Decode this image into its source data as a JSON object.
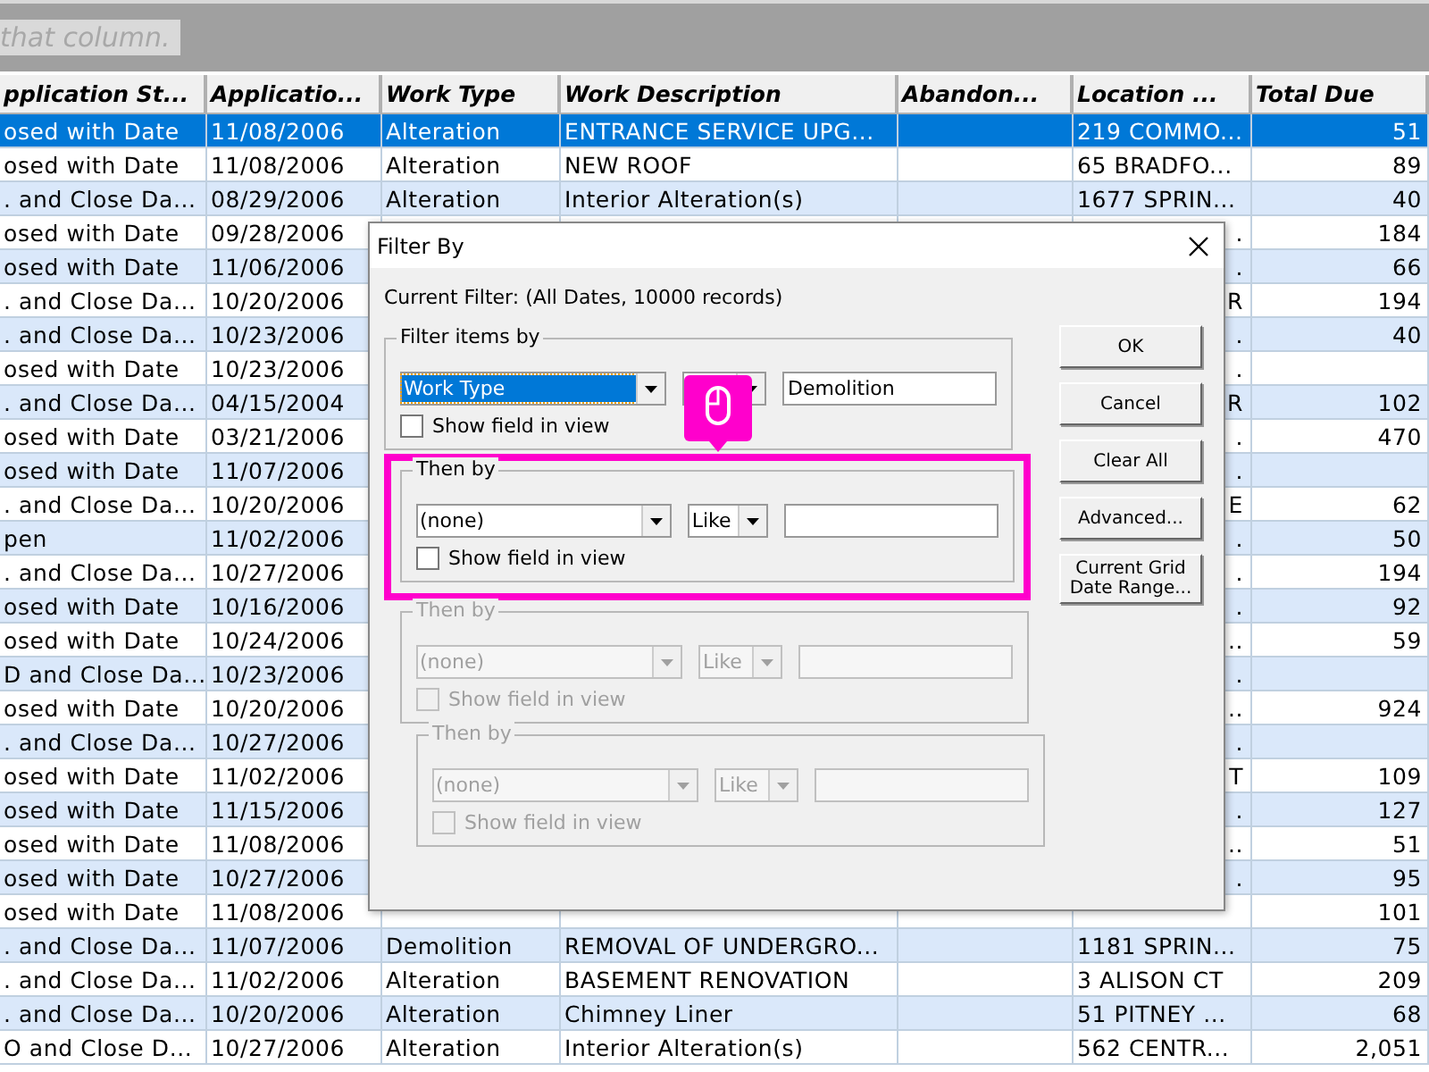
{
  "group_hint": {
    "text": "that column."
  },
  "table": {
    "columns": [
      "pplication St...",
      "Applicatio...",
      "Work Type",
      "Work Description",
      "Abandon...",
      "Location ...",
      "Total Due"
    ],
    "rows": [
      {
        "kind": "full",
        "selected": true,
        "cells": [
          "osed with Date",
          "11/08/2006",
          "Alteration",
          "ENTRANCE SERVICE UPG...",
          null,
          "219 COMMO...",
          "51"
        ]
      },
      {
        "kind": "full",
        "selected": false,
        "cells": [
          "osed with Date",
          "11/08/2006",
          "Alteration",
          "NEW ROOF",
          null,
          "65 BRADFO...",
          "89"
        ]
      },
      {
        "kind": "full",
        "selected": false,
        "cells": [
          ". and Close Da...",
          "08/29/2006",
          "Alteration",
          "Interior Alteration(s)",
          null,
          "1677 SPRIN...",
          "40"
        ]
      },
      {
        "kind": "covered",
        "selected": false,
        "cells": [
          "osed with Date",
          "09/28/2006",
          null,
          null,
          null,
          ".",
          "184"
        ]
      },
      {
        "kind": "covered",
        "selected": false,
        "cells": [
          "osed with Date",
          "11/06/2006",
          null,
          null,
          null,
          ".",
          "66"
        ]
      },
      {
        "kind": "covered",
        "selected": false,
        "cells": [
          ". and Close Da...",
          "10/20/2006",
          null,
          null,
          null,
          "R",
          "194"
        ]
      },
      {
        "kind": "covered",
        "selected": false,
        "cells": [
          ". and Close Da...",
          "10/23/2006",
          null,
          null,
          null,
          ".",
          "40"
        ]
      },
      {
        "kind": "covered",
        "selected": false,
        "cells": [
          "osed with Date",
          "10/23/2006",
          null,
          null,
          null,
          ".",
          null
        ]
      },
      {
        "kind": "covered",
        "selected": false,
        "cells": [
          ". and Close Da...",
          "04/15/2004",
          null,
          null,
          null,
          "R",
          "102"
        ]
      },
      {
        "kind": "covered",
        "selected": false,
        "cells": [
          "osed with Date",
          "03/21/2006",
          null,
          null,
          null,
          ".",
          "470"
        ]
      },
      {
        "kind": "covered",
        "selected": false,
        "cells": [
          "osed with Date",
          "11/07/2006",
          null,
          null,
          null,
          ".",
          null
        ]
      },
      {
        "kind": "covered",
        "selected": false,
        "cells": [
          ". and Close Da...",
          "10/20/2006",
          null,
          null,
          null,
          "E",
          "62"
        ]
      },
      {
        "kind": "covered",
        "selected": false,
        "cells": [
          "pen",
          "11/02/2006",
          null,
          null,
          null,
          ".",
          "50"
        ]
      },
      {
        "kind": "covered",
        "selected": false,
        "cells": [
          ". and Close Da...",
          "10/27/2006",
          null,
          null,
          null,
          ".",
          "194"
        ]
      },
      {
        "kind": "covered",
        "selected": false,
        "cells": [
          "osed with Date",
          "10/16/2006",
          null,
          null,
          null,
          ".",
          "92"
        ]
      },
      {
        "kind": "covered",
        "selected": false,
        "cells": [
          "osed with Date",
          "10/24/2006",
          null,
          null,
          null,
          "..",
          "59"
        ]
      },
      {
        "kind": "covered",
        "selected": false,
        "cells": [
          "D and Close Da...",
          "10/23/2006",
          null,
          null,
          null,
          ".",
          null
        ]
      },
      {
        "kind": "covered",
        "selected": false,
        "cells": [
          "osed with Date",
          "10/20/2006",
          null,
          null,
          null,
          "..",
          "924"
        ]
      },
      {
        "kind": "covered",
        "selected": false,
        "cells": [
          ". and Close Da...",
          "10/27/2006",
          null,
          null,
          null,
          ".",
          null
        ]
      },
      {
        "kind": "covered",
        "selected": false,
        "cells": [
          "osed with Date",
          "11/02/2006",
          null,
          null,
          null,
          "T",
          "109"
        ]
      },
      {
        "kind": "covered",
        "selected": false,
        "cells": [
          "osed with Date",
          "11/15/2006",
          null,
          null,
          null,
          ".",
          "127"
        ]
      },
      {
        "kind": "covered",
        "selected": false,
        "cells": [
          "osed with Date",
          "11/08/2006",
          null,
          null,
          null,
          "..",
          "51"
        ]
      },
      {
        "kind": "covered",
        "selected": false,
        "cells": [
          "osed with Date",
          "10/27/2006",
          null,
          null,
          null,
          ".",
          "95"
        ]
      },
      {
        "kind": "covered",
        "selected": false,
        "cells": [
          "osed with Date",
          "11/08/2006",
          null,
          null,
          null,
          null,
          "101"
        ]
      },
      {
        "kind": "full",
        "selected": false,
        "cells": [
          ". and Close Da...",
          "11/07/2006",
          "Demolition",
          "REMOVAL OF UNDERGRO...",
          null,
          "1181 SPRIN...",
          "75"
        ]
      },
      {
        "kind": "full",
        "selected": false,
        "cells": [
          ". and Close Da...",
          "11/02/2006",
          "Alteration",
          "BASEMENT RENOVATION",
          null,
          "3 ALISON CT",
          "209"
        ]
      },
      {
        "kind": "full",
        "selected": false,
        "cells": [
          ". and Close Da...",
          "10/20/2006",
          "Alteration",
          "Chimney Liner",
          null,
          "51 PITNEY ...",
          "68"
        ]
      },
      {
        "kind": "full",
        "selected": false,
        "cells": [
          "O and Close D...",
          "10/27/2006",
          "Alteration",
          "Interior Alteration(s)",
          null,
          "562 CENTR...",
          "2,051"
        ]
      }
    ]
  },
  "dialog": {
    "title": "Filter By",
    "current_filter": "Current Filter: (All Dates, 10000 records)",
    "groups": [
      {
        "title": "Filter items by",
        "field": "Work Type",
        "field_focused": true,
        "value": "Demolition",
        "show_field_in_view": false,
        "show_field_label": "Show field in view",
        "enabled": true,
        "highlighted": false
      },
      {
        "title": "Then by",
        "field": "(none)",
        "field_focused": false,
        "operator": "Like",
        "show_field_in_view": false,
        "show_field_label": "Show field in view",
        "enabled": true,
        "highlighted": true
      },
      {
        "title": "Then by",
        "field": "(none)",
        "field_focused": false,
        "operator": "Like",
        "show_field_in_view": false,
        "show_field_label": "Show field in view",
        "enabled": false,
        "highlighted": false
      },
      {
        "title": "Then by",
        "field": "(none)",
        "field_focused": false,
        "operator": "Like",
        "show_field_in_view": false,
        "show_field_label": "Show field in view",
        "enabled": false,
        "highlighted": false
      }
    ],
    "buttons": [
      "OK",
      "Cancel",
      "Clear All",
      "Advanced...",
      "Current Grid Date Range..."
    ]
  }
}
